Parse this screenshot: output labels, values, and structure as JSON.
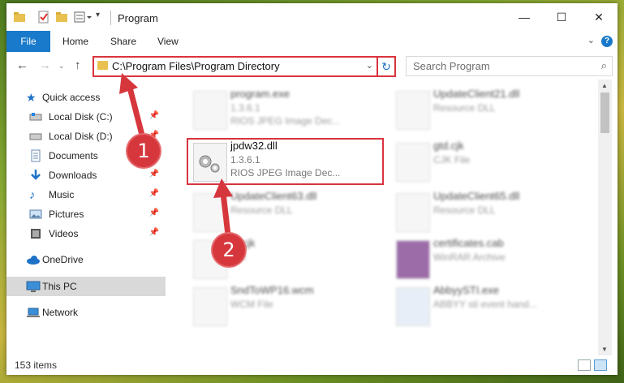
{
  "window": {
    "title": "Program",
    "minimize": "—",
    "maximize": "☐",
    "close": "✕"
  },
  "ribbon": {
    "tabs": [
      "File",
      "Home",
      "Share",
      "View"
    ],
    "help": "?"
  },
  "address": {
    "path": "C:\\Program Files\\Program Directory"
  },
  "search": {
    "placeholder": "Search Program"
  },
  "nav": {
    "items": [
      {
        "label": "Quick access"
      },
      {
        "label": "Local Disk (C:)"
      },
      {
        "label": "Local Disk (D:)"
      },
      {
        "label": "Documents"
      },
      {
        "label": "Downloads"
      },
      {
        "label": "Music"
      },
      {
        "label": "Pictures"
      },
      {
        "label": "Videos"
      },
      {
        "label": "OneDrive"
      },
      {
        "label": "This PC"
      },
      {
        "label": "Network"
      }
    ]
  },
  "files": [
    {
      "name": "program.exe",
      "version": "1.3.6.1",
      "type": "RIOS JPEG Image Dec..."
    },
    {
      "name": "UpdateClient21.dll",
      "version": "",
      "type": "Resource DLL"
    },
    {
      "name": "jpdw32.dll",
      "version": "1.3.6.1",
      "type": "RIOS JPEG Image Dec..."
    },
    {
      "name": "gtd.cjk",
      "version": "",
      "type": "CJK File"
    },
    {
      "name": "UpdateClient63.dll",
      "version": "",
      "type": "Resource DLL"
    },
    {
      "name": "UpdateClient65.dll",
      "version": "",
      "type": "Resource DLL"
    },
    {
      "name": "nt.cjk",
      "version": "",
      "type": "File"
    },
    {
      "name": "certificates.cab",
      "version": "",
      "type": "WinRAR Archive"
    },
    {
      "name": "SndToWP16.wcm",
      "version": "",
      "type": "WCM File"
    },
    {
      "name": "AbbyySTI.exe",
      "version": "",
      "type": "ABBYY sti event hand..."
    }
  ],
  "status": {
    "item_count": "153 items"
  },
  "callouts": [
    "1",
    "2"
  ],
  "colors": {
    "accent": "#1979ca",
    "highlight": "#d9333f"
  }
}
